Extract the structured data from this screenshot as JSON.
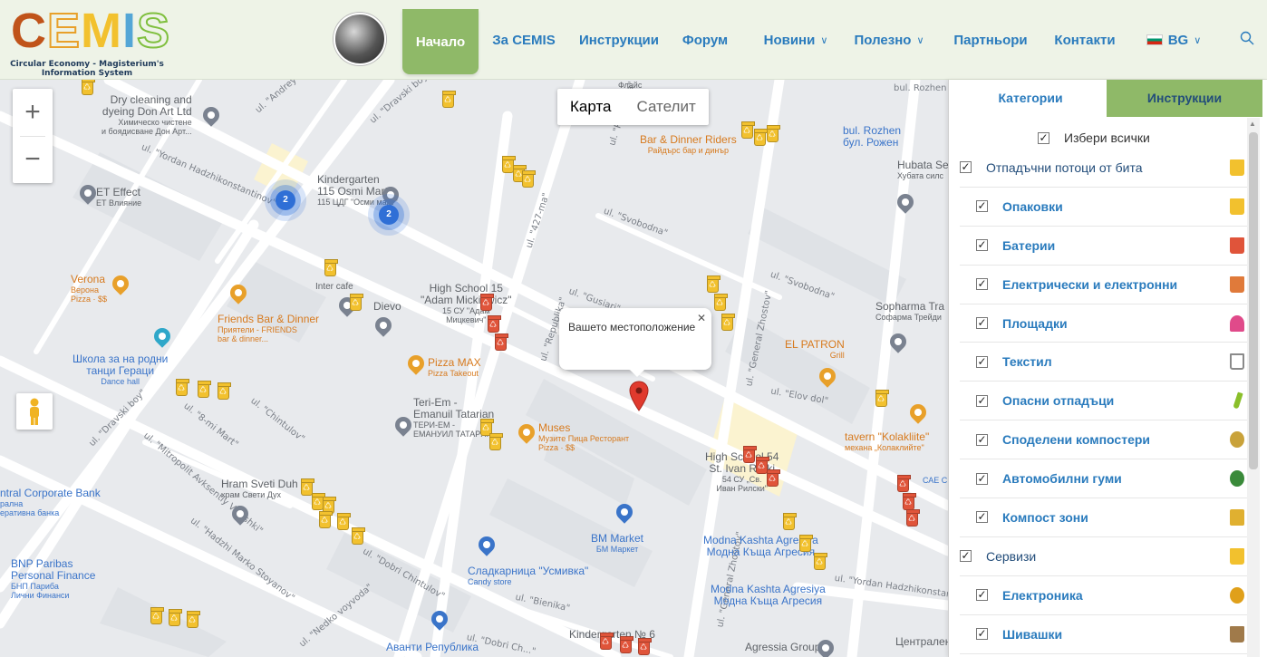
{
  "header": {
    "logo_text": "CEMIS",
    "logo_subtitle": "Circular Economy - Magisterium's Information System",
    "nav": [
      {
        "label": "Начало",
        "active": true
      },
      {
        "label": "За CEMIS"
      },
      {
        "label": "Инструкции"
      },
      {
        "label": "Форум"
      },
      {
        "label": "Новини",
        "dropdown": true
      },
      {
        "label": "Полезно",
        "dropdown": true
      },
      {
        "label": "Партньори"
      },
      {
        "label": "Контакти"
      },
      {
        "label": "BG",
        "dropdown": true
      }
    ]
  },
  "map": {
    "type_toggle": {
      "map": "Карта",
      "satellite": "Сателит"
    },
    "info_window": "Вашето местоположение",
    "streets": [
      "ul. \"Dravski boy\"",
      "ul. \"Andrey Protich\"",
      "ul. \"Yordan Hadzhikonstantinov\"",
      "ul. \"Svobodna\"",
      "ul. \"Republika\"",
      "ul. \"427-ma\"",
      "ul. \"Gusiari\"",
      "ul. \"General Zhostov\"",
      "ul. \"Elov dol\"",
      "ul. \"Chintulov\"",
      "ul. \"8-mi Mart\"",
      "ul. \"Mitropolit Avksentiy Veleshki\"",
      "ul. \"Hadzhi Marko Stoyanov\"",
      "ul. \"Dobri Chintulov\"",
      "ul. \"Nedko voyvoda\"",
      "ul. \"Bienika\"",
      "ul. \"Dobri Ch...\"",
      "bul. Rozhen"
    ],
    "pois": {
      "dry_cleaning": [
        "Dry cleaning and",
        "dyeing Don Art Ltd",
        "Химическо чистене",
        "и боядисване Дон Арт..."
      ],
      "kindergarten": [
        "Kindergarten",
        "115 Osmi Mart",
        "115 ЦДГ \"Осми март\""
      ],
      "et_effect": [
        "ET Effect",
        "ЕТ Влияние"
      ],
      "verona": [
        "Verona",
        "Верона",
        "Pizza · $$"
      ],
      "friends_bar": [
        "Friends Bar & Dinner",
        "Приятели - FRIENDS",
        "bar & dinner..."
      ],
      "inter_cafe": "Inter cafe",
      "dievo": "Dievo",
      "high_school_15": [
        "High School 15",
        "\"Adam Mickiewicz\"",
        "15 СУ \"Адам",
        "Мицкевич\""
      ],
      "pizza_max": [
        "Pizza MAX",
        "Pizza Takeout"
      ],
      "school_dances": [
        "Школа за на родни",
        "танци Гераци",
        "Dance hall"
      ],
      "teri_em": [
        "Teri-Em -",
        "Emanuil Tatarian",
        "ТЕРИ-ЕМ -",
        "ЕМАНУИЛ ТАТАРЯН"
      ],
      "muses": [
        "Muses",
        "Музите Пица Ресторант",
        "Pizza · $$"
      ],
      "bar_dinner_riders": [
        "Bar & Dinner Riders",
        "Райдърс бар и динър"
      ],
      "flais": "Флайс",
      "bul_rozhen": [
        "bul. Rozhen",
        "бул. Рожен"
      ],
      "hubata": [
        "Hubata Seals",
        "Хубата силс"
      ],
      "sopharma": [
        "Sopharma Tra",
        "Софарма Трейди"
      ],
      "el_patron": [
        "EL PATRON",
        "Grill"
      ],
      "tavern": [
        "tavern \"Kolakliite\"",
        "механа „Колаклийте\""
      ],
      "high_school_54": [
        "High School 54",
        "St. Ivan Rilski",
        "54 СУ „Св.",
        "Иван Рилски\""
      ],
      "hram": [
        "Hram Sveti Duh",
        "храм Свети Дух"
      ],
      "corporate_bank": [
        "ntral Corporate Bank",
        "рална",
        "еративна банка"
      ],
      "bnp": [
        "BNP Paribas",
        "Personal Finance",
        "БНП Париба",
        "Лични Финанси"
      ],
      "bm_market": [
        "BM Market",
        "БМ Маркет"
      ],
      "candy": [
        "Сладкарница \"Усмивка\"",
        "Candy store"
      ],
      "modna_1": [
        "Modna Kashta Agresiya",
        "Модна Къща Агресия"
      ],
      "modna_2": [
        "Modna Kashta Agresiya",
        "Модна Къща Агресия"
      ],
      "kindergarten_6": "Kindergarten № 6",
      "avanti": "Аванти Република",
      "agressia": "Agressia Group",
      "centralen": "Централен",
      "cedep": "САЕ СЕВЕР"
    },
    "clusters": [
      {
        "count": "2"
      },
      {
        "count": "2"
      }
    ]
  },
  "panel": {
    "tabs": [
      {
        "label": "Категории",
        "active": true
      },
      {
        "label": "Инструкции"
      }
    ],
    "select_all": "Избери всички",
    "rows": [
      {
        "label": "Отпадъчни потоци от бита",
        "kind": "category",
        "icon_color": "#f2c12e"
      },
      {
        "label": "Опаковки",
        "kind": "item",
        "icon_color": "#f2c12e"
      },
      {
        "label": "Батерии",
        "kind": "item",
        "icon_color": "#e0543a"
      },
      {
        "label": "Електрически и електронни",
        "kind": "item",
        "icon_color": "#e07a3a"
      },
      {
        "label": "Площадки",
        "kind": "item",
        "icon_color": "#e04a8a"
      },
      {
        "label": "Текстил",
        "kind": "item",
        "icon_color": "#b9b9b9"
      },
      {
        "label": "Опасни отпадъци",
        "kind": "item",
        "icon_color": "#8abf2a"
      },
      {
        "label": "Споделени компостери",
        "kind": "item",
        "icon_color": "#c9a23a"
      },
      {
        "label": "Автомобилни гуми",
        "kind": "item",
        "icon_color": "#3a8a3a"
      },
      {
        "label": "Компост зони",
        "kind": "item",
        "icon_color": "#e0b030"
      },
      {
        "label": "Сервизи",
        "kind": "category",
        "icon_color": "#f2c12e"
      },
      {
        "label": "Електроника",
        "kind": "item",
        "icon_color": "#e0a01a"
      },
      {
        "label": "Шивашки",
        "kind": "item",
        "icon_color": "#a07a4a"
      }
    ]
  }
}
